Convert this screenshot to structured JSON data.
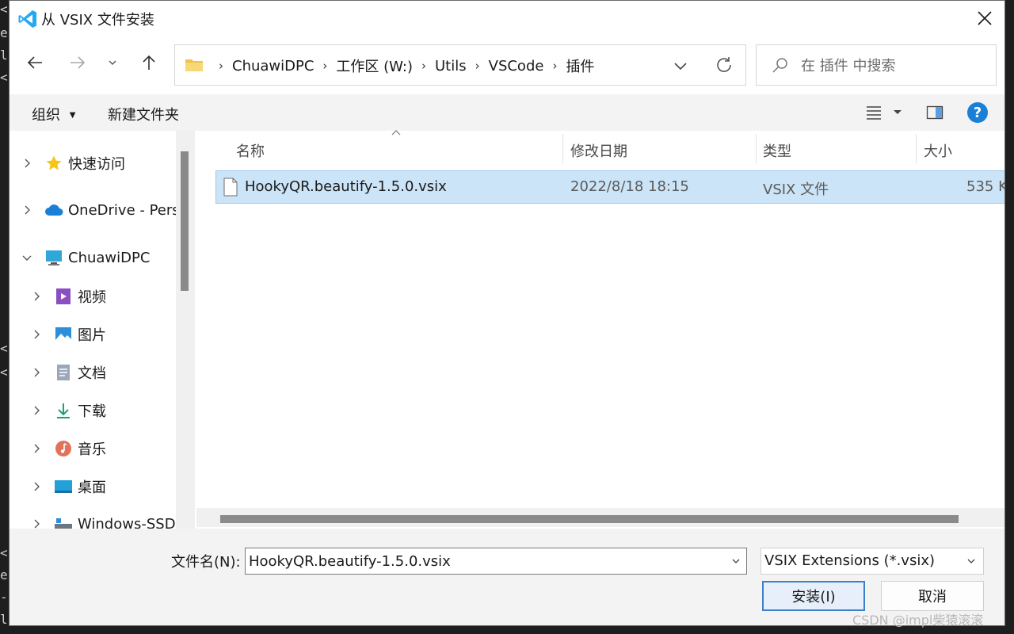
{
  "window": {
    "title": "从 VSIX 文件安装",
    "close_icon": "close-icon"
  },
  "nav": {
    "back_icon": "back-arrow-icon",
    "forward_icon": "forward-arrow-icon",
    "recent_icon": "chevron-down-icon",
    "up_icon": "up-arrow-icon"
  },
  "address": {
    "crumbs": [
      "ChuawiDPC",
      "工作区 (W:)",
      "Utils",
      "VSCode",
      "插件"
    ],
    "folder_color": "#f2c14e"
  },
  "search": {
    "placeholder": "在 插件 中搜索"
  },
  "toolbar": {
    "organize": "组织",
    "new_folder": "新建文件夹",
    "help": "?"
  },
  "sidebar": {
    "items": [
      {
        "label": "快速访问",
        "icon": "star-icon"
      },
      {
        "label": "OneDrive - Pers",
        "icon": "cloud-icon"
      },
      {
        "label": "ChuawiDPC",
        "icon": "computer-icon"
      },
      {
        "label": "视频",
        "icon": "video-icon"
      },
      {
        "label": "图片",
        "icon": "picture-icon"
      },
      {
        "label": "文档",
        "icon": "document-icon"
      },
      {
        "label": "下载",
        "icon": "download-icon"
      },
      {
        "label": "音乐",
        "icon": "music-icon"
      },
      {
        "label": "桌面",
        "icon": "desktop-icon"
      },
      {
        "label": "Windows-SSD",
        "icon": "drive-icon"
      }
    ]
  },
  "columns": {
    "name": "名称",
    "modified": "修改日期",
    "type": "类型",
    "size": "大小"
  },
  "files": [
    {
      "name": "HookyQR.beautify-1.5.0.vsix",
      "modified": "2022/8/18 18:15",
      "type": "VSIX 文件",
      "size": "535 K"
    }
  ],
  "bottom": {
    "filename_label": "文件名(N):",
    "filename_value": "HookyQR.beautify-1.5.0.vsix",
    "filter_value": "VSIX Extensions (*.vsix)",
    "install_label": "安装(I)",
    "cancel_label": "取消"
  },
  "watermark": "CSDN @impl柴猿滚滚",
  "background_chars": [
    "<",
    "e",
    "l",
    "<",
    "<",
    "<",
    "<",
    "e",
    "-",
    "l"
  ],
  "colors": {
    "accent": "#3c80c8",
    "selection": "#cce4f7",
    "vscode_blue": "#23a9f2"
  }
}
